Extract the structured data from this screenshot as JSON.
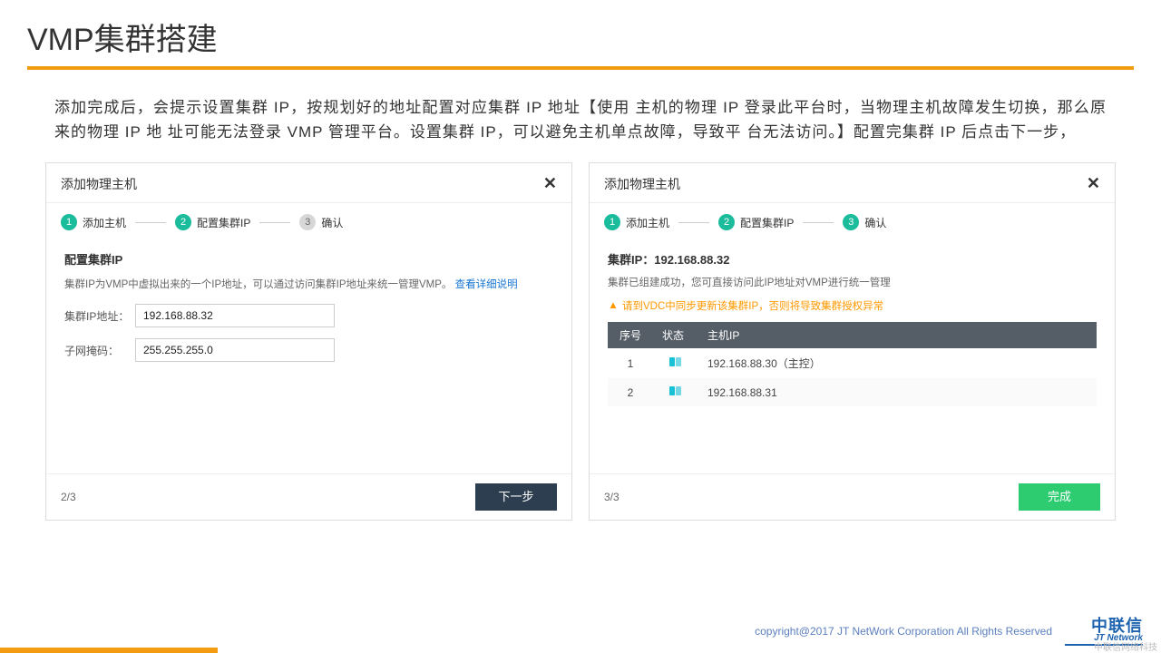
{
  "page": {
    "title": "VMP集群搭建",
    "intro": "添加完成后，会提示设置集群 IP，按规划好的地址配置对应集群 IP 地址【使用 主机的物理 IP 登录此平台时，当物理主机故障发生切换，那么原来的物理 IP 地 址可能无法登录 VMP 管理平台。设置集群 IP，可以避免主机单点故障，导致平 台无法访问。】配置完集群 IP 后点击下一步，"
  },
  "left_panel": {
    "header": "添加物理主机",
    "steps": [
      {
        "num": "1",
        "label": "添加主机",
        "active": true
      },
      {
        "num": "2",
        "label": "配置集群IP",
        "active": true
      },
      {
        "num": "3",
        "label": "确认",
        "active": false
      }
    ],
    "section_title": "配置集群IP",
    "desc_text": "集群IP为VMP中虚拟出来的一个IP地址，可以通过访问集群IP地址来统一管理VMP。",
    "desc_link": "查看详细说明",
    "fields": {
      "ip_label": "集群IP地址：",
      "ip_value": "192.168.88.32",
      "mask_label": "子网掩码：",
      "mask_value": "255.255.255.0"
    },
    "page_indicator": "2/3",
    "next_button": "下一步"
  },
  "right_panel": {
    "header": "添加物理主机",
    "steps": [
      {
        "num": "1",
        "label": "添加主机",
        "active": true
      },
      {
        "num": "2",
        "label": "配置集群IP",
        "active": true
      },
      {
        "num": "3",
        "label": "确认",
        "active": true
      }
    ],
    "cluster_title": "集群IP：192.168.88.32",
    "cluster_desc": "集群已组建成功，您可直接访问此IP地址对VMP进行统一管理",
    "warning": "请到VDC中同步更新该集群IP，否则将导致集群授权异常",
    "table": {
      "headers": {
        "seq": "序号",
        "state": "状态",
        "host_ip": "主机IP"
      },
      "rows": [
        {
          "seq": "1",
          "host_ip": "192.168.88.30（主控）"
        },
        {
          "seq": "2",
          "host_ip": "192.168.88.31"
        }
      ]
    },
    "page_indicator": "3/3",
    "finish_button": "完成"
  },
  "footer": {
    "copyright": "copyright@2017 JT NetWork Corporation All Rights Reserved",
    "brand_cn": "中联信",
    "brand_en": "JT Network",
    "watermark": "中联信网络科技"
  }
}
